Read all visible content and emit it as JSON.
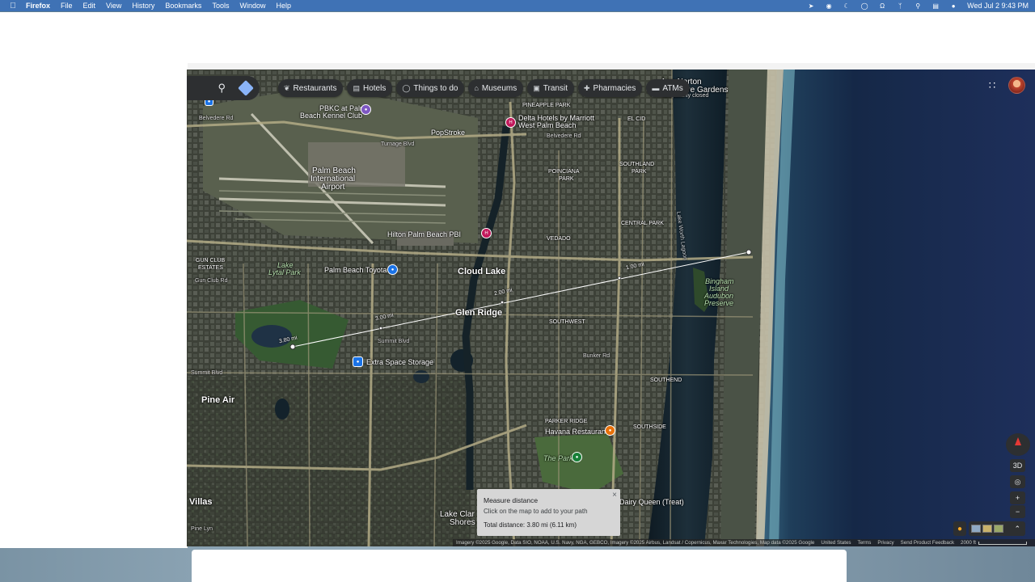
{
  "menubar": {
    "app": "Firefox",
    "items": [
      "File",
      "Edit",
      "View",
      "History",
      "Bookmarks",
      "Tools",
      "Window",
      "Help"
    ],
    "clock": "Wed Jul 2  9:43 PM",
    "status_icons": [
      "rocket-icon",
      "cast-icon",
      "moon-icon",
      "account-circle-icon",
      "headphones-icon",
      "bluetooth-icon",
      "search-icon",
      "control-center-icon",
      "flag-icon"
    ]
  },
  "maps": {
    "chips": [
      "Restaurants",
      "Hotels",
      "Things to do",
      "Museums",
      "Transit",
      "Pharmacies",
      "ATMs"
    ],
    "labels": {
      "ann_norton": "Ann Norton",
      "sculpture_gardens": "Sculpture Gardens",
      "temporarily_closed": "Temporarily closed",
      "pbkc": "PBKC at Palm",
      "pbkc2": "Beach Kennel Club",
      "delta1": "Delta Hotels by Marriott",
      "delta2": "West Palm Beach",
      "pineapple_park": "PINEAPPLE PARK",
      "el_cid": "EL CID",
      "popstroke": "PopStroke",
      "pbia1": "Palm Beach",
      "pbia2": "International",
      "pbia3": "Airport",
      "poinciana1": "POINCIANA",
      "poinciana2": "PARK",
      "southland1": "SOUTHLAND",
      "southland2": "PARK",
      "central_park": "CENTRAL PARK",
      "lake_worth_lagoon": "Lake Worth Lagoon",
      "hilton": "Hilton Palm Beach PBI",
      "vedado": "VEDADO",
      "gun_club1": "GUN CLUB",
      "gun_club2": "ESTATES",
      "lake_lytal1": "Lake",
      "lake_lytal2": "Lytal Park",
      "pb_toyota": "Palm Beach Toyota",
      "cloud_lake": "Cloud Lake",
      "gun_club_rd": "Gun Club Rd",
      "bingham1": "Bingham",
      "bingham2": "Island",
      "bingham3": "Audubon",
      "bingham4": "Preserve",
      "glen_ridge": "Glen Ridge",
      "southwest": "SOUTHWEST",
      "summit_blvd": "Summit Blvd",
      "summit_blvd2": "Summit Blvd",
      "extra_space": "Extra Space Storage",
      "bunker_rd": "Bunker Rd",
      "southend": "SOUTHEND",
      "pine_air": "Pine Air",
      "parker_ridge": "PARKER RIDGE",
      "havana": "Havana Restaurant",
      "southside": "SOUTHSIDE",
      "the_park": "The Park",
      "villas": "Villas",
      "lake_clarke1": "Lake Clar",
      "lake_clarke2": "Shores",
      "dairy_queen": "Dairy Queen (Treat)",
      "pine_lyn": "Pine Lyn",
      "belvedere_rd": "Belvedere Rd",
      "belvedere_rd2": "Belvedere Rd",
      "turnage": "Turnage Blvd",
      "dist_1": "1.00 mi",
      "dist_2": "2.00 mi",
      "dist_3": "3.00 mi",
      "dist_4": "3.80 mi"
    },
    "measure": {
      "title": "Measure distance",
      "instruction": "Click on the map to add to your path",
      "total": "Total distance: 3.80 mi (6.11 km)"
    },
    "controls": {
      "three_d": "3D",
      "zoom_in": "+",
      "zoom_out": "−"
    },
    "footer": {
      "attribution": "Imagery ©2025 Google, Data SIO, NOAA, U.S. Navy, NGA, GEBCO, Imagery ©2025 Airbus, Landsat / Copernicus, Maxar Technologies, Map data ©2025 Google",
      "country": "United States",
      "terms": "Terms",
      "privacy": "Privacy",
      "feedback": "Send Product Feedback",
      "scale": "2000 ft"
    }
  }
}
